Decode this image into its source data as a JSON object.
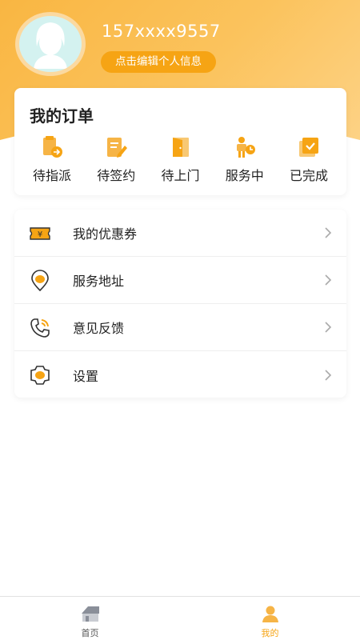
{
  "profile": {
    "phone": "157xxxx9557",
    "edit_label": "点击编辑个人信息"
  },
  "orders": {
    "title": "我的订单",
    "items": [
      {
        "label": "待指派",
        "icon": "assign-icon"
      },
      {
        "label": "待签约",
        "icon": "sign-icon"
      },
      {
        "label": "待上门",
        "icon": "door-icon"
      },
      {
        "label": "服务中",
        "icon": "worker-icon"
      },
      {
        "label": "已完成",
        "icon": "completed-icon"
      }
    ]
  },
  "menu": {
    "items": [
      {
        "label": "我的优惠券",
        "icon": "coupon-icon"
      },
      {
        "label": "服务地址",
        "icon": "location-icon"
      },
      {
        "label": "意见反馈",
        "icon": "phone-feedback-icon"
      },
      {
        "label": "设置",
        "icon": "settings-gear-icon"
      }
    ]
  },
  "tabbar": {
    "tabs": [
      {
        "label": "首页",
        "icon": "home-icon",
        "active": false
      },
      {
        "label": "我的",
        "icon": "user-icon",
        "active": true
      }
    ]
  },
  "colors": {
    "accent": "#f6a414",
    "header_gradient_start": "#f9b642",
    "header_gradient_end": "#fdd285",
    "text": "#222222"
  }
}
